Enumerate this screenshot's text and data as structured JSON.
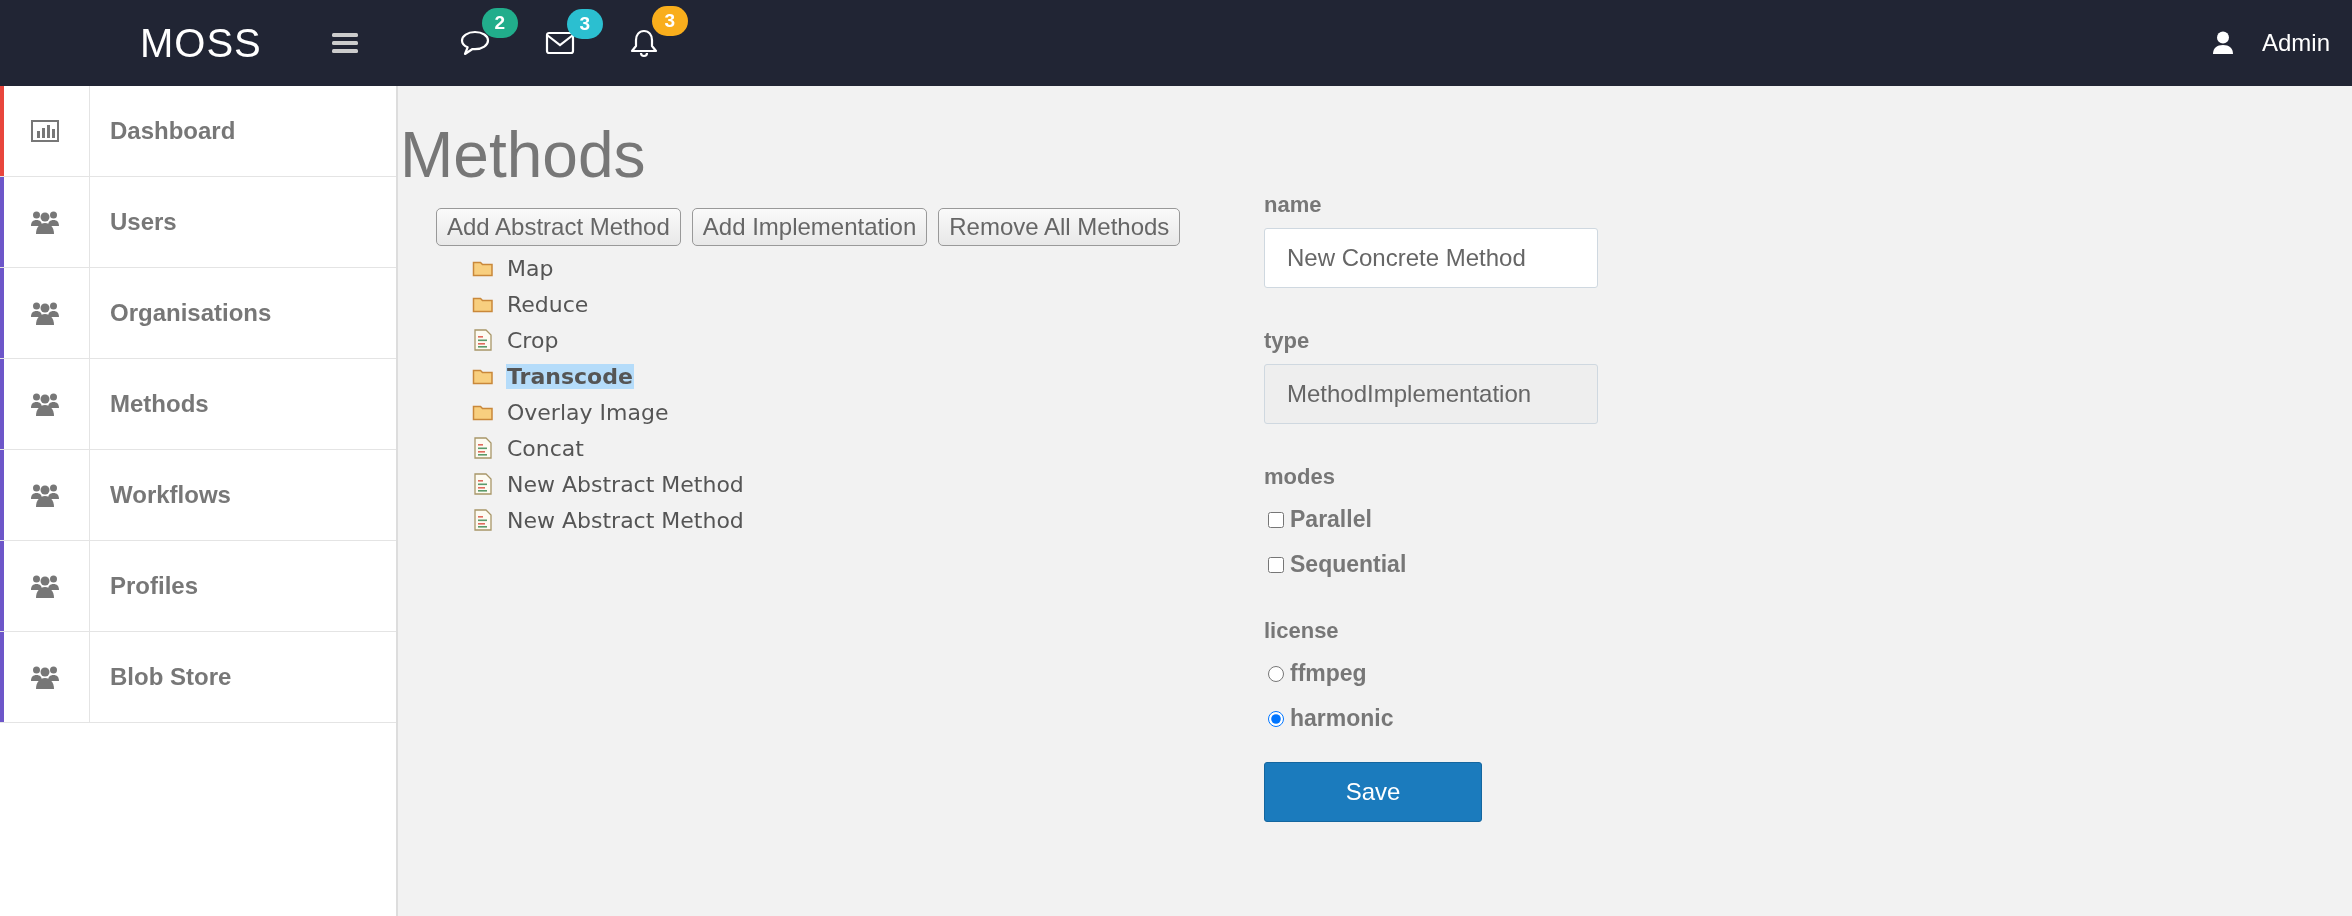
{
  "topbar": {
    "brand": "MOSS",
    "notifications": [
      {
        "kind": "chat",
        "count": "2",
        "color": "#21ad8b"
      },
      {
        "kind": "mail",
        "count": "3",
        "color": "#2bbfd0"
      },
      {
        "kind": "bell",
        "count": "3",
        "color": "#f9ae1c"
      }
    ],
    "user": "Admin"
  },
  "sidebar": {
    "items": [
      {
        "label": "Dashboard",
        "kind": "chart",
        "color": "#e8453c"
      },
      {
        "label": "Users",
        "kind": "users",
        "color": "#6d56c9"
      },
      {
        "label": "Organisations",
        "kind": "users",
        "color": "#6d56c9"
      },
      {
        "label": "Methods",
        "kind": "users",
        "color": "#6d56c9"
      },
      {
        "label": "Workflows",
        "kind": "users",
        "color": "#6d56c9"
      },
      {
        "label": "Profiles",
        "kind": "users",
        "color": "#6d56c9"
      },
      {
        "label": "Blob Store",
        "kind": "users",
        "color": "#6d56c9"
      }
    ]
  },
  "page": {
    "title": "Methods"
  },
  "toolbar": [
    "Add Abstract Method",
    "Add Implementation",
    "Remove All Methods"
  ],
  "tree": [
    {
      "label": "Map",
      "kind": "folder",
      "selected": false
    },
    {
      "label": "Reduce",
      "kind": "folder",
      "selected": false
    },
    {
      "label": "Crop",
      "kind": "file",
      "selected": false
    },
    {
      "label": "Transcode",
      "kind": "folder",
      "selected": true
    },
    {
      "label": "Overlay Image",
      "kind": "folder",
      "selected": false
    },
    {
      "label": "Concat",
      "kind": "file",
      "selected": false
    },
    {
      "label": "New Abstract Method",
      "kind": "file",
      "selected": false
    },
    {
      "label": "New Abstract Method",
      "kind": "file",
      "selected": false
    }
  ],
  "form": {
    "name": {
      "label": "name",
      "value": "New Concrete Method"
    },
    "type": {
      "label": "type",
      "value": "MethodImplementation",
      "disabled": true
    },
    "modes": {
      "label": "modes",
      "options": [
        {
          "label": "Parallel",
          "checked": false
        },
        {
          "label": "Sequential",
          "checked": false
        }
      ]
    },
    "license": {
      "label": "license",
      "options": [
        {
          "label": "ffmpeg",
          "selected": false
        },
        {
          "label": "harmonic",
          "selected": true
        }
      ]
    },
    "save": "Save"
  }
}
